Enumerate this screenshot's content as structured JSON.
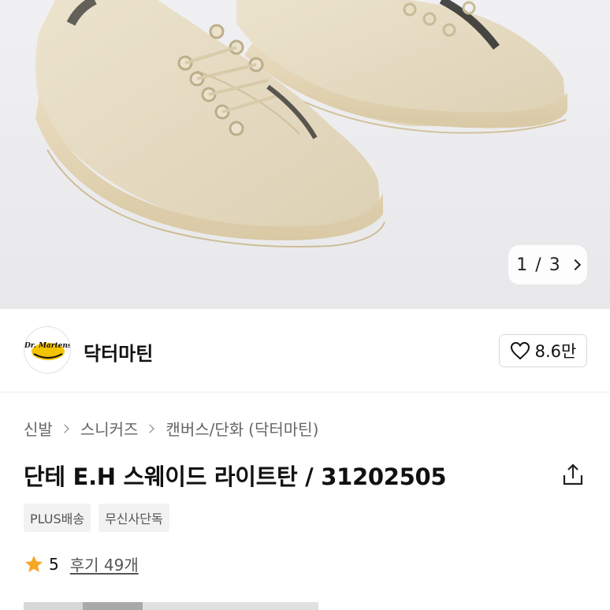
{
  "gallery": {
    "current": "1",
    "separator": "/",
    "total": "3",
    "next_icon": "chevron-right-icon"
  },
  "brand": {
    "name": "닥터마틴",
    "logo_text": "Dr. Martens",
    "like_icon": "heart-outline-icon",
    "like_count": "8.6만"
  },
  "breadcrumb": {
    "items": [
      "신발",
      "스니커즈",
      "캔버스/단화"
    ],
    "brand_tag": "(닥터마틴)"
  },
  "product": {
    "title": "단테 E.H 스웨이드 라이트탄 / 31202505",
    "share_icon": "share-icon"
  },
  "tags": [
    "PLUS배송",
    "무신사단독"
  ],
  "rating": {
    "star_icon": "star-icon",
    "star_color": "#f5a623",
    "score": "5",
    "reviews": "후기 49개"
  },
  "colors": {
    "hero_bg": "#ededef",
    "shoe_upper": "#e6dcc4",
    "shoe_sole": "#e3d5b6"
  }
}
